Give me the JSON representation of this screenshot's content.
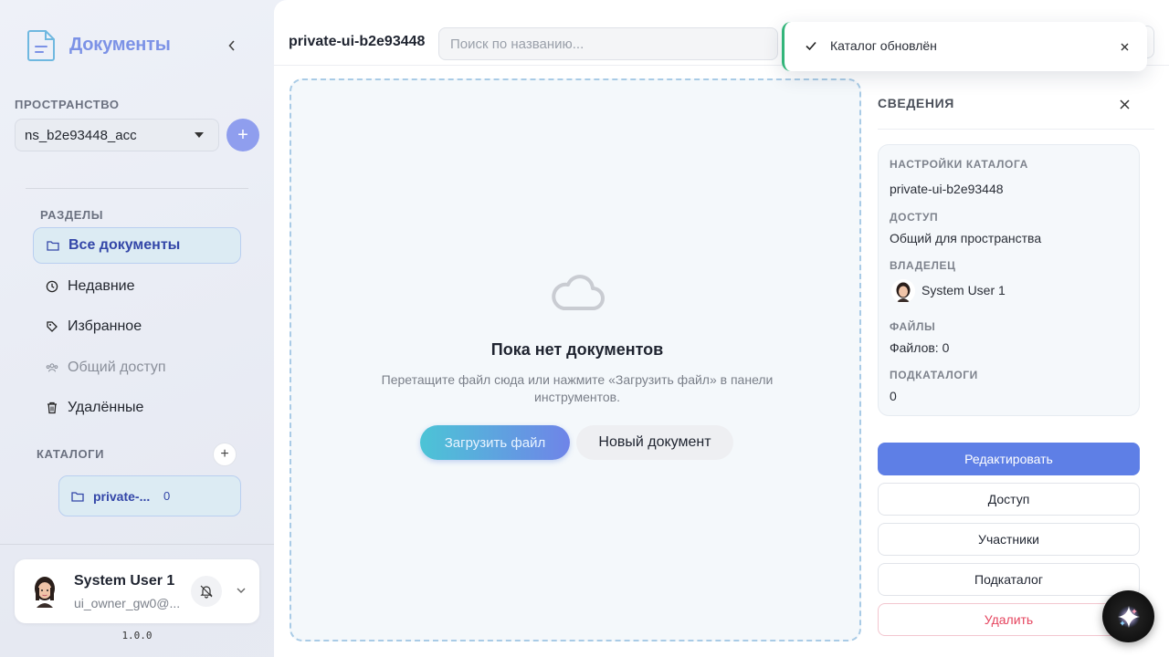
{
  "app": {
    "title": "Документы",
    "version": "1.0.0"
  },
  "namespace": {
    "label": "ПРОСТРАНСТВО",
    "selected": "ns_b2e93448_acc",
    "add_label": "+"
  },
  "sections": {
    "label": "РАЗДЕЛЫ",
    "items": [
      {
        "label": "Все документы",
        "icon": "folder-icon"
      },
      {
        "label": "Недавние",
        "icon": "clock-icon"
      },
      {
        "label": "Избранное",
        "icon": "tag-icon"
      },
      {
        "label": "Общий доступ",
        "icon": "users-icon"
      },
      {
        "label": "Удалённые",
        "icon": "trash-icon"
      }
    ]
  },
  "catalogs": {
    "label": "КАТАЛОГИ",
    "add_label": "+",
    "items": [
      {
        "label": "private-...",
        "count": "0"
      }
    ]
  },
  "user": {
    "name": "System User 1",
    "email": "ui_owner_gw0@..."
  },
  "topbar": {
    "catalog_title": "private-ui-b2e93448",
    "search_placeholder": "Поиск по названию..."
  },
  "empty_state": {
    "title": "Пока нет документов",
    "description": "Перетащите файл сюда или нажмите «Загрузить файл» в панели инструментов.",
    "upload_label": "Загрузить файл",
    "new_doc_label": "Новый документ"
  },
  "details": {
    "title": "СВЕДЕНИЯ",
    "settings_label": "НАСТРОЙКИ КАТАЛОГА",
    "settings_value": "private-ui-b2e93448",
    "access_label": "ДОСТУП",
    "access_value": "Общий для пространства",
    "owner_label": "ВЛАДЕЛЕЦ",
    "owner_value": "System User 1",
    "files_label": "ФАЙЛЫ",
    "files_value": "Файлов: 0",
    "subcatalogs_label": "ПОДКАТАЛОГИ",
    "subcatalogs_value": "0",
    "actions": {
      "edit": "Редактировать",
      "access": "Доступ",
      "members": "Участники",
      "subcatalog": "Подкаталог",
      "delete": "Удалить"
    }
  },
  "toast": {
    "message": "Каталог обновлён"
  },
  "colors": {
    "accent": "#5e7fe6",
    "brand": "#7c92e6",
    "success": "#33b57a",
    "danger": "#e5445e"
  }
}
